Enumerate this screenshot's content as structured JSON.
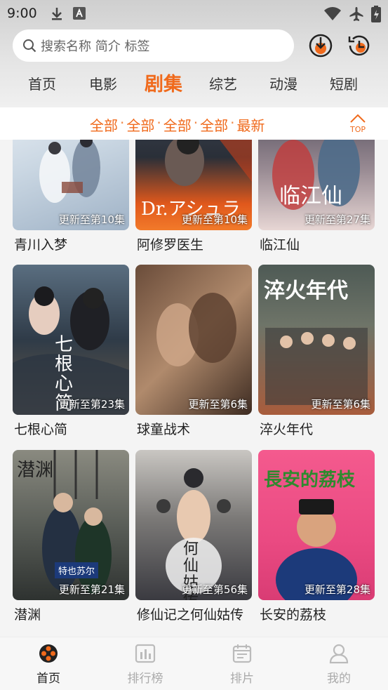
{
  "status": {
    "time": "9:00"
  },
  "search": {
    "placeholder": "搜索名称 简介 标签"
  },
  "tabs": [
    {
      "label": "首页"
    },
    {
      "label": "电影"
    },
    {
      "label": "剧集",
      "active": true
    },
    {
      "label": "综艺"
    },
    {
      "label": "动漫"
    },
    {
      "label": "短剧"
    }
  ],
  "filter": {
    "items": [
      "全部",
      "全部",
      "全部",
      "全部",
      "最新"
    ],
    "top_label": "TOP"
  },
  "shows": [
    {
      "title": "青川入梦",
      "badge": "更新至第10集"
    },
    {
      "title": "阿修罗医生",
      "badge": "更新至第10集",
      "poster_text": "Dr.アシュラ"
    },
    {
      "title": "临江仙",
      "badge": "更新至第27集",
      "poster_text": "临江仙"
    },
    {
      "title": "七根心简",
      "badge": "更新至第23集",
      "poster_text": "七根心简"
    },
    {
      "title": "球童战术",
      "badge": "更新至第6集"
    },
    {
      "title": "淬火年代",
      "badge": "更新至第6集",
      "poster_text": "淬火年代"
    },
    {
      "title": "潜渊",
      "badge": "更新至第21集",
      "poster_text": "特也苏尔"
    },
    {
      "title": "修仙记之何仙姑传",
      "badge": "更新至第56集",
      "poster_text": "何仙姑传"
    },
    {
      "title": "长安的荔枝",
      "badge": "更新至第28集",
      "poster_text": "長安的荔枝"
    }
  ],
  "bottom_nav": [
    {
      "label": "首页",
      "icon": "film-reel-icon",
      "active": true
    },
    {
      "label": "排行榜",
      "icon": "chart-icon"
    },
    {
      "label": "排片",
      "icon": "calendar-icon"
    },
    {
      "label": "我的",
      "icon": "user-icon"
    }
  ],
  "colors": {
    "accent": "#f06a1c",
    "inactive": "#aaaaaa"
  }
}
